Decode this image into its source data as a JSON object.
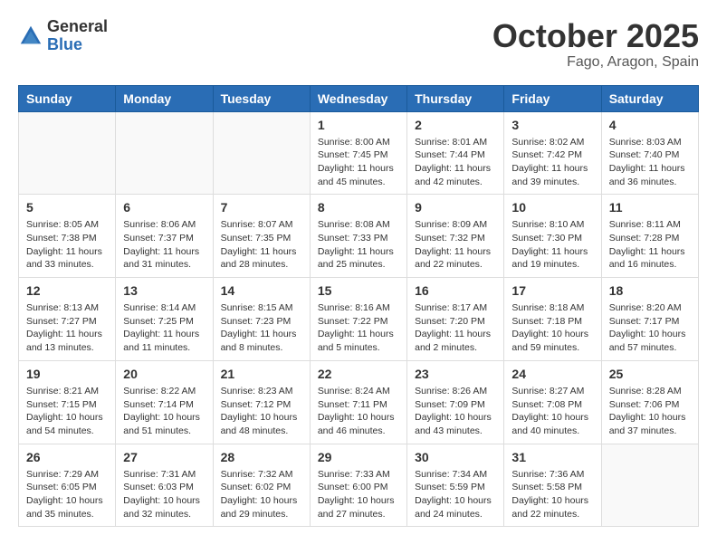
{
  "header": {
    "logo_general": "General",
    "logo_blue": "Blue",
    "month_title": "October 2025",
    "location": "Fago, Aragon, Spain"
  },
  "weekdays": [
    "Sunday",
    "Monday",
    "Tuesday",
    "Wednesday",
    "Thursday",
    "Friday",
    "Saturday"
  ],
  "weeks": [
    [
      {
        "day": "",
        "info": ""
      },
      {
        "day": "",
        "info": ""
      },
      {
        "day": "",
        "info": ""
      },
      {
        "day": "1",
        "info": "Sunrise: 8:00 AM\nSunset: 7:45 PM\nDaylight: 11 hours\nand 45 minutes."
      },
      {
        "day": "2",
        "info": "Sunrise: 8:01 AM\nSunset: 7:44 PM\nDaylight: 11 hours\nand 42 minutes."
      },
      {
        "day": "3",
        "info": "Sunrise: 8:02 AM\nSunset: 7:42 PM\nDaylight: 11 hours\nand 39 minutes."
      },
      {
        "day": "4",
        "info": "Sunrise: 8:03 AM\nSunset: 7:40 PM\nDaylight: 11 hours\nand 36 minutes."
      }
    ],
    [
      {
        "day": "5",
        "info": "Sunrise: 8:05 AM\nSunset: 7:38 PM\nDaylight: 11 hours\nand 33 minutes."
      },
      {
        "day": "6",
        "info": "Sunrise: 8:06 AM\nSunset: 7:37 PM\nDaylight: 11 hours\nand 31 minutes."
      },
      {
        "day": "7",
        "info": "Sunrise: 8:07 AM\nSunset: 7:35 PM\nDaylight: 11 hours\nand 28 minutes."
      },
      {
        "day": "8",
        "info": "Sunrise: 8:08 AM\nSunset: 7:33 PM\nDaylight: 11 hours\nand 25 minutes."
      },
      {
        "day": "9",
        "info": "Sunrise: 8:09 AM\nSunset: 7:32 PM\nDaylight: 11 hours\nand 22 minutes."
      },
      {
        "day": "10",
        "info": "Sunrise: 8:10 AM\nSunset: 7:30 PM\nDaylight: 11 hours\nand 19 minutes."
      },
      {
        "day": "11",
        "info": "Sunrise: 8:11 AM\nSunset: 7:28 PM\nDaylight: 11 hours\nand 16 minutes."
      }
    ],
    [
      {
        "day": "12",
        "info": "Sunrise: 8:13 AM\nSunset: 7:27 PM\nDaylight: 11 hours\nand 13 minutes."
      },
      {
        "day": "13",
        "info": "Sunrise: 8:14 AM\nSunset: 7:25 PM\nDaylight: 11 hours\nand 11 minutes."
      },
      {
        "day": "14",
        "info": "Sunrise: 8:15 AM\nSunset: 7:23 PM\nDaylight: 11 hours\nand 8 minutes."
      },
      {
        "day": "15",
        "info": "Sunrise: 8:16 AM\nSunset: 7:22 PM\nDaylight: 11 hours\nand 5 minutes."
      },
      {
        "day": "16",
        "info": "Sunrise: 8:17 AM\nSunset: 7:20 PM\nDaylight: 11 hours\nand 2 minutes."
      },
      {
        "day": "17",
        "info": "Sunrise: 8:18 AM\nSunset: 7:18 PM\nDaylight: 10 hours\nand 59 minutes."
      },
      {
        "day": "18",
        "info": "Sunrise: 8:20 AM\nSunset: 7:17 PM\nDaylight: 10 hours\nand 57 minutes."
      }
    ],
    [
      {
        "day": "19",
        "info": "Sunrise: 8:21 AM\nSunset: 7:15 PM\nDaylight: 10 hours\nand 54 minutes."
      },
      {
        "day": "20",
        "info": "Sunrise: 8:22 AM\nSunset: 7:14 PM\nDaylight: 10 hours\nand 51 minutes."
      },
      {
        "day": "21",
        "info": "Sunrise: 8:23 AM\nSunset: 7:12 PM\nDaylight: 10 hours\nand 48 minutes."
      },
      {
        "day": "22",
        "info": "Sunrise: 8:24 AM\nSunset: 7:11 PM\nDaylight: 10 hours\nand 46 minutes."
      },
      {
        "day": "23",
        "info": "Sunrise: 8:26 AM\nSunset: 7:09 PM\nDaylight: 10 hours\nand 43 minutes."
      },
      {
        "day": "24",
        "info": "Sunrise: 8:27 AM\nSunset: 7:08 PM\nDaylight: 10 hours\nand 40 minutes."
      },
      {
        "day": "25",
        "info": "Sunrise: 8:28 AM\nSunset: 7:06 PM\nDaylight: 10 hours\nand 37 minutes."
      }
    ],
    [
      {
        "day": "26",
        "info": "Sunrise: 7:29 AM\nSunset: 6:05 PM\nDaylight: 10 hours\nand 35 minutes."
      },
      {
        "day": "27",
        "info": "Sunrise: 7:31 AM\nSunset: 6:03 PM\nDaylight: 10 hours\nand 32 minutes."
      },
      {
        "day": "28",
        "info": "Sunrise: 7:32 AM\nSunset: 6:02 PM\nDaylight: 10 hours\nand 29 minutes."
      },
      {
        "day": "29",
        "info": "Sunrise: 7:33 AM\nSunset: 6:00 PM\nDaylight: 10 hours\nand 27 minutes."
      },
      {
        "day": "30",
        "info": "Sunrise: 7:34 AM\nSunset: 5:59 PM\nDaylight: 10 hours\nand 24 minutes."
      },
      {
        "day": "31",
        "info": "Sunrise: 7:36 AM\nSunset: 5:58 PM\nDaylight: 10 hours\nand 22 minutes."
      },
      {
        "day": "",
        "info": ""
      }
    ]
  ]
}
